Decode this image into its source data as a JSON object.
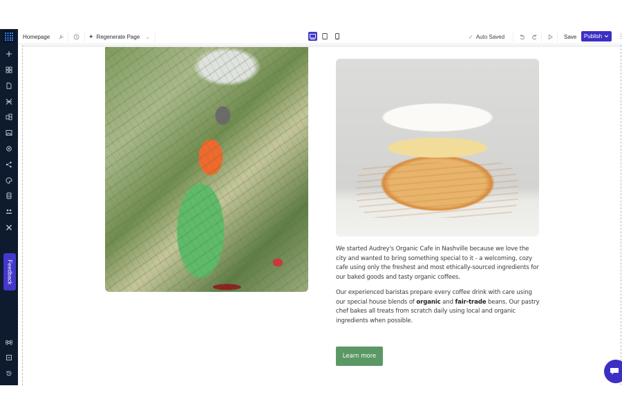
{
  "app": {
    "logo_icon": "grid-logo-icon"
  },
  "toolbar": {
    "page_name": "Homepage",
    "icons": {
      "settings": "wrench-icon",
      "history": "clock-icon"
    },
    "regenerate_label": "Regenerate Page",
    "regenerate_icon": "sparkle-icon",
    "regenerate_chevron": "chevron-down-icon",
    "devices": [
      {
        "name": "desktop",
        "icon": "desktop-icon",
        "active": true
      },
      {
        "name": "tablet",
        "icon": "tablet-icon",
        "active": false
      },
      {
        "name": "mobile",
        "icon": "mobile-icon",
        "active": false
      }
    ],
    "status_icon": "check-icon",
    "status_label": "Auto Saved",
    "undo_icon": "undo-icon",
    "redo_icon": "redo-icon",
    "preview_icon": "play-icon",
    "save_label": "Save",
    "publish_label": "Publish",
    "more_icon": "more-icon"
  },
  "sidebar": {
    "items": [
      {
        "name": "add",
        "icon": "plus-icon"
      },
      {
        "name": "sections",
        "icon": "sections-icon"
      },
      {
        "name": "pages",
        "icon": "page-icon"
      },
      {
        "name": "layouts",
        "icon": "layout-icon"
      },
      {
        "name": "components",
        "icon": "components-icon"
      },
      {
        "name": "media",
        "icon": "image-icon"
      },
      {
        "name": "settings",
        "icon": "gear-icon"
      },
      {
        "name": "integrations",
        "icon": "nodes-icon"
      },
      {
        "name": "theme",
        "icon": "palette-icon"
      },
      {
        "name": "database",
        "icon": "database-icon"
      },
      {
        "name": "team",
        "icon": "users-icon"
      },
      {
        "name": "tools",
        "icon": "tools-icon"
      }
    ],
    "feedback_label": "Feedback",
    "bottom_items": [
      {
        "name": "shortcuts",
        "icon": "command-icon"
      },
      {
        "name": "docs",
        "icon": "book-icon"
      },
      {
        "name": "history",
        "icon": "restore-icon"
      }
    ]
  },
  "content": {
    "image_left_alt": "Coffee farmer picking coffee cherries",
    "image_right_alt": "Meringue-topped pastry cross-section",
    "paragraph_1": "We started Audrey's Organic Cafe in Nashville because we love the city and wanted to bring something special to it - a welcoming, cozy cafe using only the freshest and most ethically-sourced ingredients for our baked goods and tasty organic coffees.",
    "paragraph_2_parts": {
      "a": "Our experienced baristas prepare every coffee drink with care using our special house blends of ",
      "b": "organic",
      "c": " and ",
      "d": "fair-trade",
      "e": " beans. Our pastry chef bakes all treats from scratch daily using local and organic ingredients when possible."
    },
    "cta_label": "Learn more"
  },
  "chat": {
    "icon": "chat-icon"
  },
  "colors": {
    "sidebar_bg": "#0e1a2e",
    "accent": "#3b2fc4",
    "cta_green": "#5b9865"
  }
}
